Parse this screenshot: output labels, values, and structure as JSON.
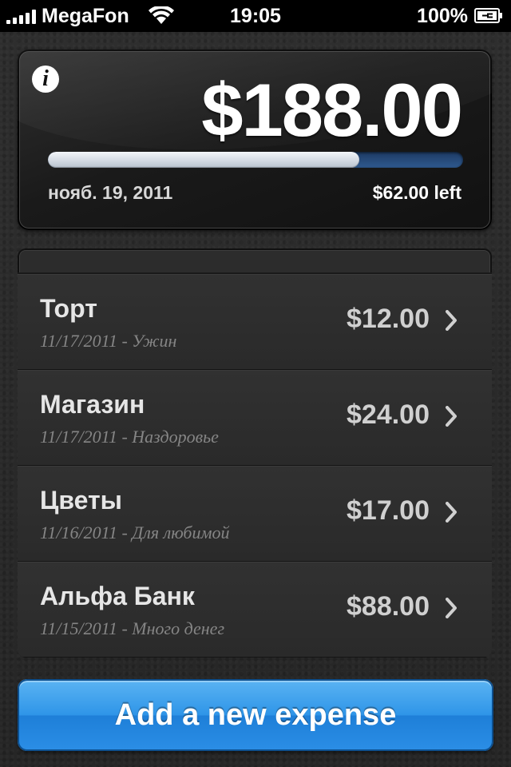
{
  "status_bar": {
    "carrier": "MegaFon",
    "time": "19:05",
    "battery": "100%"
  },
  "summary": {
    "total": "$188.00",
    "progress_fraction": 0.75,
    "date": "нояб. 19, 2011",
    "left": "$62.00 left",
    "info_glyph": "i"
  },
  "expenses": [
    {
      "name": "Торт",
      "subtitle": "11/17/2011 - Ужин",
      "amount": "$12.00"
    },
    {
      "name": "Магазин",
      "subtitle": "11/17/2011 - Наздоровье",
      "amount": "$24.00"
    },
    {
      "name": "Цветы",
      "subtitle": "11/16/2011 - Для любимой",
      "amount": "$17.00"
    },
    {
      "name": "Альфа Банк",
      "subtitle": "11/15/2011 - Много денег",
      "amount": "$88.00"
    }
  ],
  "add_button": {
    "label": "Add a new expense"
  },
  "colors": {
    "accent": "#2f95e8",
    "progress_track": "#2f5a8f"
  }
}
